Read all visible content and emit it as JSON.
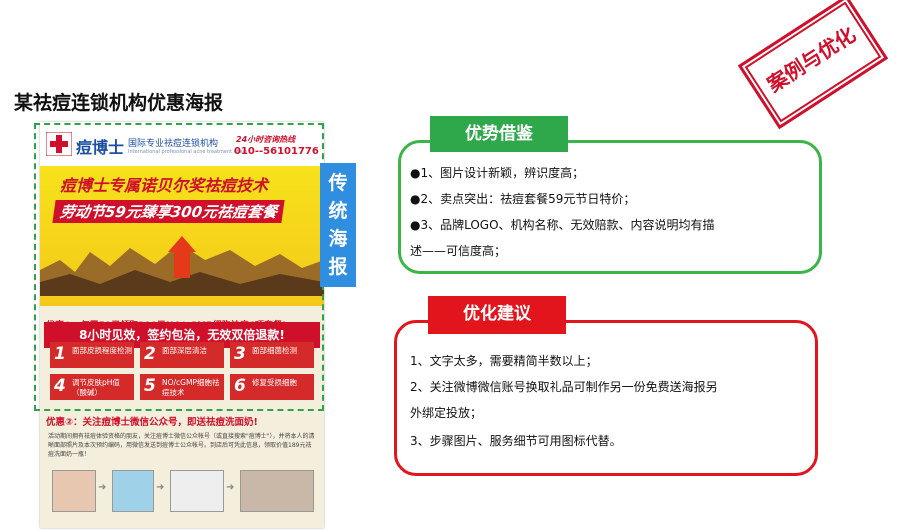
{
  "page_title": "某祛痘连锁机构优惠海报",
  "stamp": "案例与优化",
  "vertical_tag": [
    "传",
    "统",
    "海",
    "报"
  ],
  "poster": {
    "brand_name": "痘博士",
    "brand_sub": "国际专业祛痘连锁机构",
    "brand_en": "International professional acne treatment chain",
    "hotline_label": "24小时咨询热线",
    "hotline_number": "010--56101776",
    "hero_line1": "痘博士专属诺贝尔奖祛痘技术",
    "hero_line2": "劳动节59元臻享300元祛痘套餐",
    "hero_banner": "8小时见效，签约包治，无效双倍退款!",
    "offer1_title": "优惠①：仅需59元领取300元NO/cGMP细胞祛痘6项套餐!",
    "services": [
      {
        "num": "1",
        "text": "面部皮损程度检测"
      },
      {
        "num": "2",
        "text": "面部深层清洁"
      },
      {
        "num": "3",
        "text": "面部细菌检测"
      },
      {
        "num": "4",
        "text": "调节皮肤pH值（酸碱）"
      },
      {
        "num": "5",
        "text": "NO/cGMP细胞祛痘技术"
      },
      {
        "num": "6",
        "text": "修复受损细胞"
      }
    ],
    "offer2_title": "优惠②：关注痘博士微信公众号，即送祛痘洗面奶!",
    "offer2_body": "活动期间拥有祛痘体验资格的朋友，关注痘博士微信公众帐号（或直接搜索\"痘博士\"），并将本人的清晰面部照片及本次预约编码，用微信发送到痘博士公众帐号。到店后可凭此信息，领取价值189元祛痘洗面奶一瓶！"
  },
  "advantages": {
    "title": "优势借鉴",
    "lines": [
      "●1、图片设计新颖，辨识度高；",
      "●2、卖点突出：祛痘套餐59元节日特价；",
      "●3、品牌LOGO、机构名称、无效赔款、内容说明均有描",
      "述——可信度高；"
    ]
  },
  "optimization": {
    "title": "优化建议",
    "lines": [
      "1、文字太多，需要精简半数以上；",
      "2、关注微博微信账号换取礼品可制作另一份免费送海报另",
      "外绑定投放；",
      "3、步骤图片、服务细节可用图标代替。"
    ]
  },
  "colors": {
    "green": "#2ea84a",
    "red": "#e2141c",
    "blue": "#2f8ee0",
    "yellow": "#f7e21b"
  }
}
